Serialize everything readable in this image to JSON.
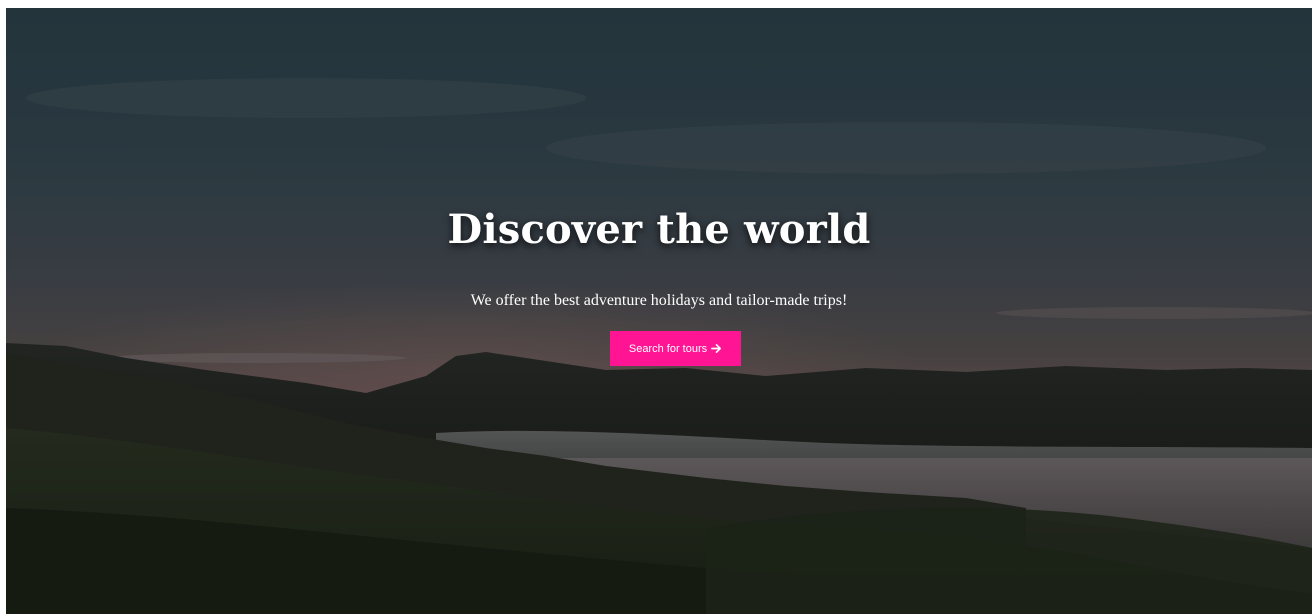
{
  "hero": {
    "title": "Discover the world",
    "subtitle": "We offer the best adventure holidays and tailor-made trips!",
    "cta_label": "Search for tours",
    "cta_icon": "arrow-right-icon",
    "accent_color": "#ff1493"
  }
}
